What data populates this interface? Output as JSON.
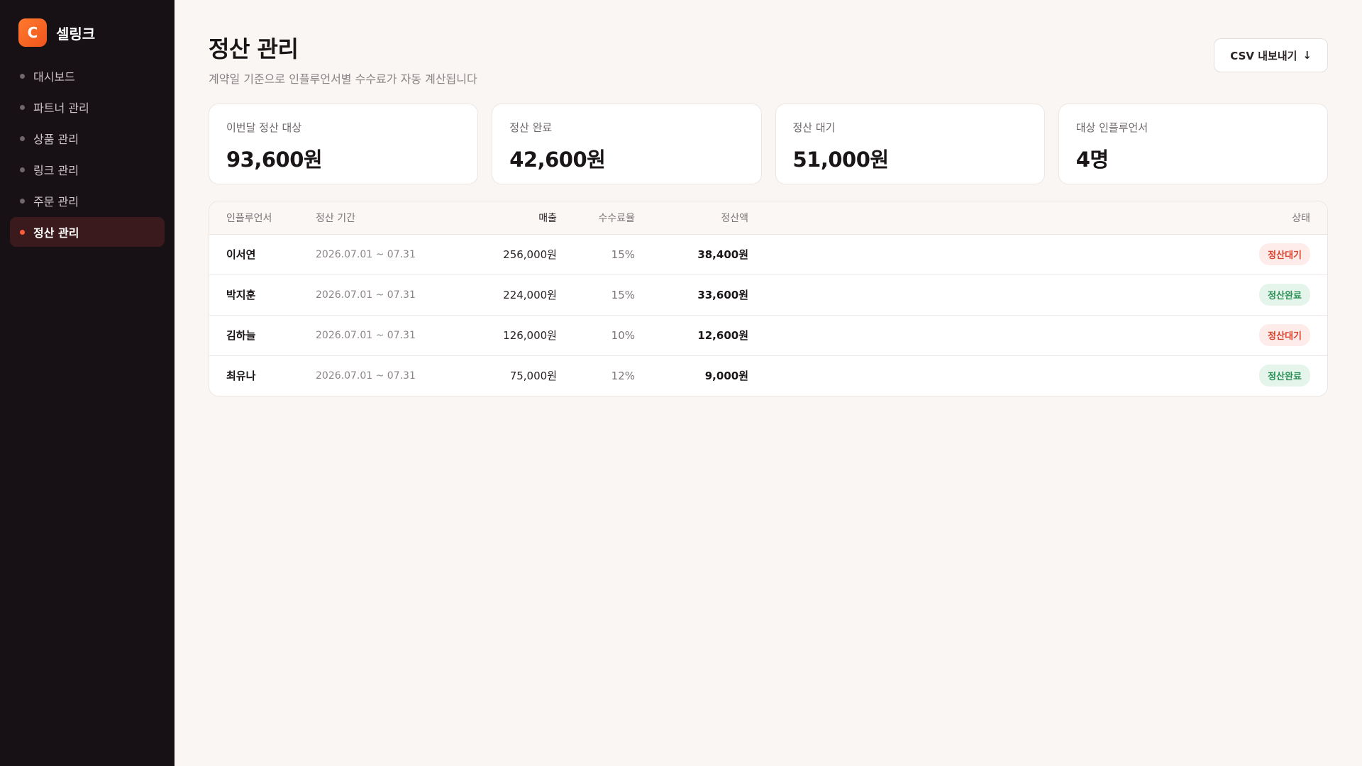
{
  "brand": {
    "logo_letter": "C",
    "name": "셀링크"
  },
  "sidebar": {
    "items": [
      {
        "label": "대시보드",
        "active": false
      },
      {
        "label": "파트너 관리",
        "active": false
      },
      {
        "label": "상품 관리",
        "active": false
      },
      {
        "label": "링크 관리",
        "active": false
      },
      {
        "label": "주문 관리",
        "active": false
      },
      {
        "label": "정산 관리",
        "active": true
      }
    ]
  },
  "header": {
    "title": "정산 관리",
    "subtitle": "계약일 기준으로 인플루언서별 수수료가 자동 계산됩니다",
    "export_label": "CSV 내보내기",
    "export_icon": "↓"
  },
  "stats": [
    {
      "label": "이번달 정산 대상",
      "value": "93,600원"
    },
    {
      "label": "정산 완료",
      "value": "42,600원"
    },
    {
      "label": "정산 대기",
      "value": "51,000원"
    },
    {
      "label": "대상 인플루언서",
      "value": "4명"
    }
  ],
  "table": {
    "headers": {
      "name": "인플루언서",
      "period": "정산 기간",
      "sales": "매출",
      "rate": "수수료율",
      "amount": "정산액",
      "status": "상태"
    },
    "rows": [
      {
        "name": "이서연",
        "period": "2026.07.01 ~ 07.31",
        "sales": "256,000원",
        "rate": "15%",
        "amount": "38,400원",
        "status": "정산대기",
        "status_type": "pending"
      },
      {
        "name": "박지훈",
        "period": "2026.07.01 ~ 07.31",
        "sales": "224,000원",
        "rate": "15%",
        "amount": "33,600원",
        "status": "정산완료",
        "status_type": "done"
      },
      {
        "name": "김하늘",
        "period": "2026.07.01 ~ 07.31",
        "sales": "126,000원",
        "rate": "10%",
        "amount": "12,600원",
        "status": "정산대기",
        "status_type": "pending"
      },
      {
        "name": "최유나",
        "period": "2026.07.01 ~ 07.31",
        "sales": "75,000원",
        "rate": "12%",
        "amount": "9,000원",
        "status": "정산완료",
        "status_type": "done"
      }
    ]
  },
  "colors": {
    "sidebar_bg": "#171115",
    "accent": "#ff5b3a",
    "pending": "#d9452f",
    "done": "#2a8f55"
  }
}
